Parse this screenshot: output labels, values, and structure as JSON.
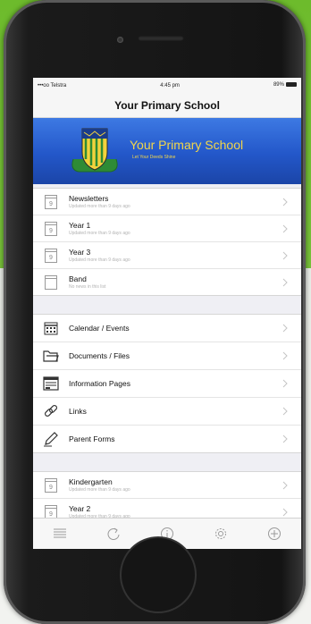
{
  "status": {
    "carrier": "•••oo Telstra",
    "time": "4:45 pm",
    "battery": "89%"
  },
  "nav": {
    "title": "Your Primary School"
  },
  "banner": {
    "title": "Your Primary School",
    "motto": "Let Your Deeds Shine"
  },
  "news_top": [
    {
      "icon_text": "9",
      "title": "Newsletters",
      "subtitle": "Updated more than 9 days ago"
    },
    {
      "icon_text": "9",
      "title": "Year 1",
      "subtitle": "Updated more than 9 days ago"
    },
    {
      "icon_text": "9",
      "title": "Year 3",
      "subtitle": "Updated more than 9 days ago"
    },
    {
      "icon_text": "",
      "title": "Band",
      "subtitle": "No news in this list"
    }
  ],
  "menu": [
    {
      "title": "Calendar / Events",
      "icon": "calendar-icon"
    },
    {
      "title": "Documents / Files",
      "icon": "folder-icon"
    },
    {
      "title": "Information Pages",
      "icon": "pages-icon"
    },
    {
      "title": "Links",
      "icon": "link-icon"
    },
    {
      "title": "Parent Forms",
      "icon": "pencil-icon"
    }
  ],
  "news_bottom": [
    {
      "icon_text": "9",
      "title": "Kindergarten",
      "subtitle": "Updated more than 9 days ago"
    },
    {
      "icon_text": "9",
      "title": "Year 2",
      "subtitle": "Updated more than 9 days ago"
    }
  ],
  "tabbar": [
    "list-icon",
    "refresh-icon",
    "info-icon",
    "settings-icon",
    "add-icon"
  ]
}
